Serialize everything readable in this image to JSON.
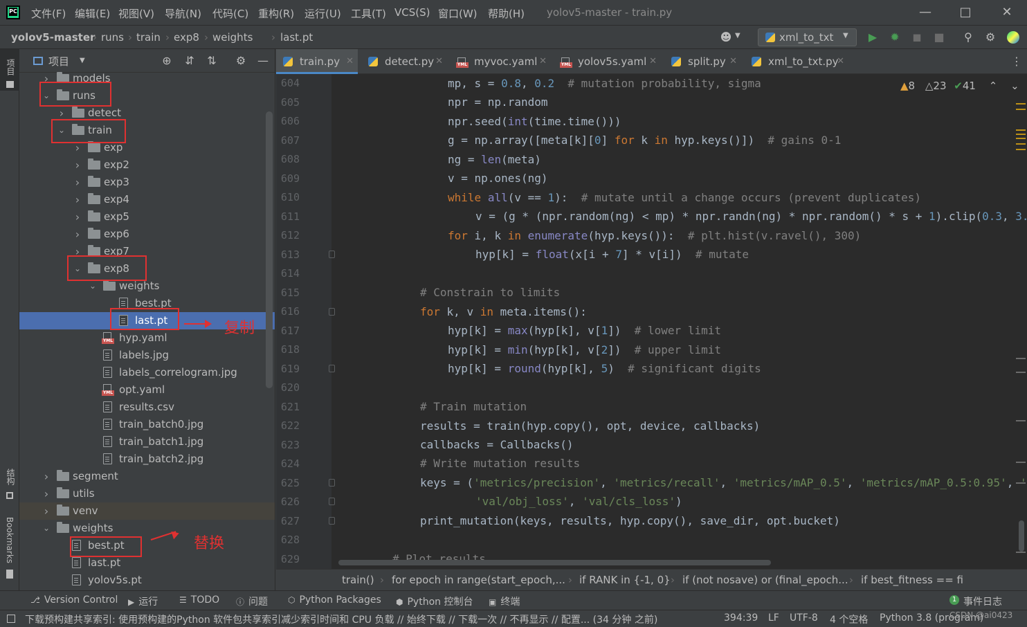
{
  "app": {
    "logo_text": "PC",
    "menu": [
      "文件(F)",
      "编辑(E)",
      "视图(V)",
      "导航(N)",
      "代码(C)",
      "重构(R)",
      "运行(U)",
      "工具(T)",
      "VCS(S)",
      "窗口(W)",
      "帮助(H)"
    ],
    "window_title": "yolov5-master - train.py"
  },
  "breadcrumb": [
    "yolov5-master",
    "runs",
    "train",
    "exp8",
    "weights",
    "last.pt"
  ],
  "run_config": "xml_to_txt",
  "left_strip": {
    "top": "项目",
    "middle": "结构",
    "bottom": "Bookmarks"
  },
  "project_panel": {
    "title": "项目",
    "tree": [
      {
        "label": "models",
        "depth": 0,
        "kind": "folder",
        "open": false
      },
      {
        "label": "runs",
        "depth": 0,
        "kind": "folder",
        "open": true
      },
      {
        "label": "detect",
        "depth": 1,
        "kind": "folder",
        "open": false
      },
      {
        "label": "train",
        "depth": 1,
        "kind": "folder",
        "open": true
      },
      {
        "label": "exp",
        "depth": 2,
        "kind": "folder",
        "open": false
      },
      {
        "label": "exp2",
        "depth": 2,
        "kind": "folder",
        "open": false
      },
      {
        "label": "exp3",
        "depth": 2,
        "kind": "folder",
        "open": false
      },
      {
        "label": "exp4",
        "depth": 2,
        "kind": "folder",
        "open": false
      },
      {
        "label": "exp5",
        "depth": 2,
        "kind": "folder",
        "open": false
      },
      {
        "label": "exp6",
        "depth": 2,
        "kind": "folder",
        "open": false
      },
      {
        "label": "exp7",
        "depth": 2,
        "kind": "folder",
        "open": false
      },
      {
        "label": "exp8",
        "depth": 2,
        "kind": "folder",
        "open": true
      },
      {
        "label": "weights",
        "depth": 3,
        "kind": "folder",
        "open": true
      },
      {
        "label": "best.pt",
        "depth": 4,
        "kind": "file"
      },
      {
        "label": "last.pt",
        "depth": 4,
        "kind": "file",
        "selected": true
      },
      {
        "label": "hyp.yaml",
        "depth": 3,
        "kind": "yaml"
      },
      {
        "label": "labels.jpg",
        "depth": 3,
        "kind": "file"
      },
      {
        "label": "labels_correlogram.jpg",
        "depth": 3,
        "kind": "file"
      },
      {
        "label": "opt.yaml",
        "depth": 3,
        "kind": "yaml"
      },
      {
        "label": "results.csv",
        "depth": 3,
        "kind": "file"
      },
      {
        "label": "train_batch0.jpg",
        "depth": 3,
        "kind": "file"
      },
      {
        "label": "train_batch1.jpg",
        "depth": 3,
        "kind": "file"
      },
      {
        "label": "train_batch2.jpg",
        "depth": 3,
        "kind": "file"
      },
      {
        "label": "segment",
        "depth": 0,
        "kind": "folder",
        "open": false
      },
      {
        "label": "utils",
        "depth": 0,
        "kind": "folder",
        "open": false
      },
      {
        "label": "venv",
        "depth": 0,
        "kind": "folder",
        "open": false,
        "venv": true
      },
      {
        "label": "weights",
        "depth": 0,
        "kind": "folder",
        "open": true
      },
      {
        "label": "best.pt",
        "depth": 1,
        "kind": "file"
      },
      {
        "label": "last.pt",
        "depth": 1,
        "kind": "file"
      },
      {
        "label": "yolov5s.pt",
        "depth": 1,
        "kind": "file"
      }
    ],
    "annotation_copy": "复制",
    "annotation_replace": "替换"
  },
  "tabs": [
    {
      "label": "train.py",
      "kind": "py",
      "active": true
    },
    {
      "label": "detect.py",
      "kind": "py"
    },
    {
      "label": "myvoc.yaml",
      "kind": "yaml"
    },
    {
      "label": "yolov5s.yaml",
      "kind": "yaml"
    },
    {
      "label": "split.py",
      "kind": "py"
    },
    {
      "label": "xml_to_txt.py",
      "kind": "py"
    }
  ],
  "inspections": {
    "errors": "8",
    "warnings": "23",
    "ok": "41"
  },
  "line_numbers": [
    "604",
    "605",
    "606",
    "607",
    "608",
    "609",
    "610",
    "611",
    "612",
    "613",
    "614",
    "615",
    "616",
    "617",
    "618",
    "619",
    "620",
    "621",
    "622",
    "623",
    "624",
    "625",
    "626",
    "627",
    "628",
    "629"
  ],
  "code_crumbs": [
    "train()",
    "for epoch in range(start_epoch,...",
    "if RANK in {-1, 0}",
    "if (not nosave) or (final_epoch...",
    "if best_fitness == fi"
  ],
  "tool_windows": [
    "Version Control",
    "运行",
    "TODO",
    "问题",
    "Python Packages",
    "Python 控制台",
    "终端"
  ],
  "event_log": {
    "count": "1",
    "label": "事件日志"
  },
  "status": {
    "message": "下载预构建共享索引: 使用预构建的Python 软件包共享索引减少索引时间和 CPU 负载 // 始终下载 // 下载一次 // 不再显示 // 配置... (34 分钟 之前)",
    "position": "394:39",
    "line_sep": "LF",
    "encoding": "UTF-8",
    "indent": "4 个空格",
    "interpreter": "Python 3.8 (program)",
    "watermark": "CSDN @ai0423"
  }
}
